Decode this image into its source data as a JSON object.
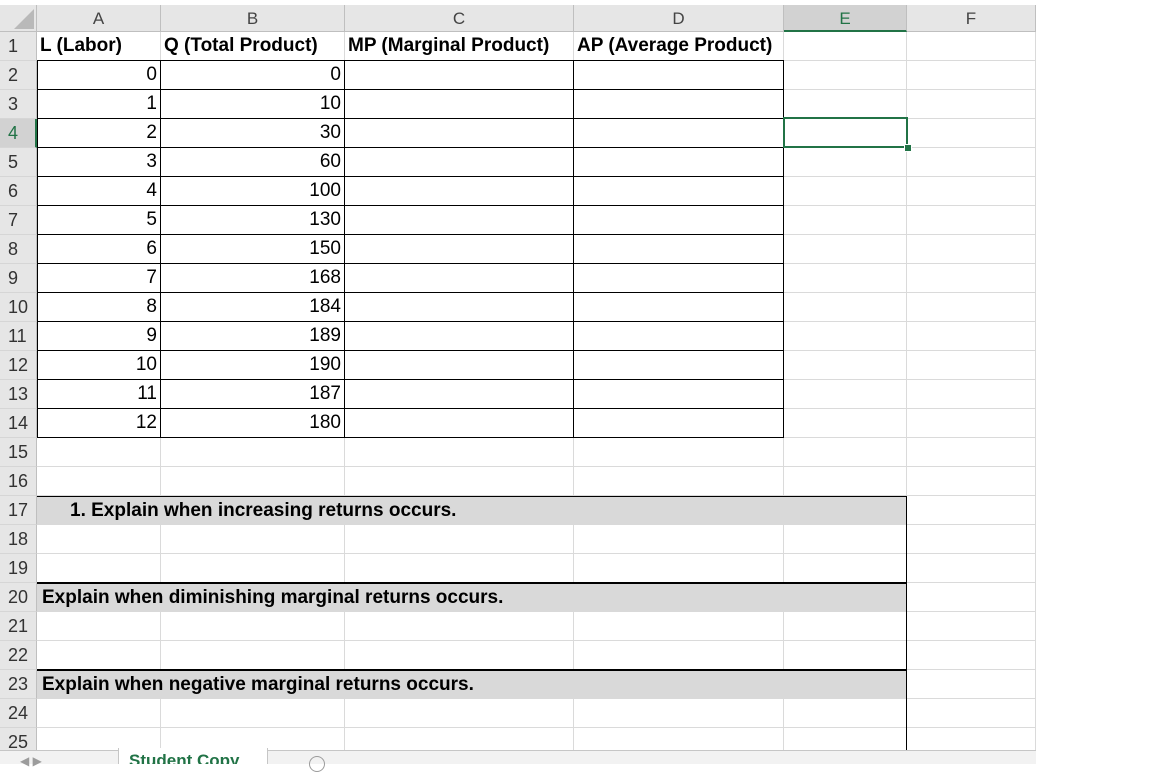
{
  "columns": [
    "A",
    "B",
    "C",
    "D",
    "E",
    "F"
  ],
  "active_column": "E",
  "active_row": 4,
  "rows": [
    "1",
    "2",
    "3",
    "4",
    "5",
    "6",
    "7",
    "8",
    "9",
    "10",
    "11",
    "12",
    "13",
    "14",
    "15",
    "16",
    "17",
    "18",
    "19",
    "20",
    "21",
    "22",
    "23",
    "24",
    "25"
  ],
  "headers": {
    "a": "L (Labor)",
    "b": "Q (Total Product)",
    "c": "MP (Marginal Product)",
    "d": "AP (Average Product)"
  },
  "table": [
    {
      "l": "0",
      "q": "0"
    },
    {
      "l": "1",
      "q": "10"
    },
    {
      "l": "2",
      "q": "30"
    },
    {
      "l": "3",
      "q": "60"
    },
    {
      "l": "4",
      "q": "100"
    },
    {
      "l": "5",
      "q": "130"
    },
    {
      "l": "6",
      "q": "150"
    },
    {
      "l": "7",
      "q": "168"
    },
    {
      "l": "8",
      "q": "184"
    },
    {
      "l": "9",
      "q": "189"
    },
    {
      "l": "10",
      "q": "190"
    },
    {
      "l": "11",
      "q": "187"
    },
    {
      "l": "12",
      "q": "180"
    }
  ],
  "questions": [
    "1. Explain when increasing returns occurs.",
    "Explain when diminishing marginal returns occurs.",
    "Explain when negative marginal returns occurs."
  ],
  "sheet_tab": "Student Copy",
  "accent_color": "#217346"
}
